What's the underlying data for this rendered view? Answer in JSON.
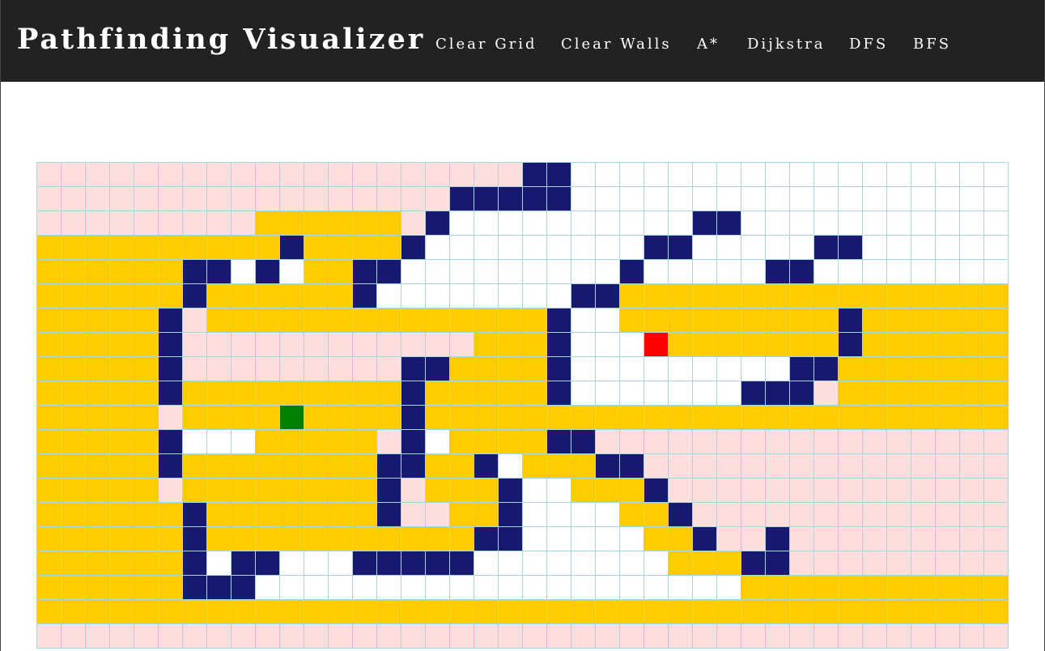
{
  "app": {
    "title": "Pathfinding Visualizer",
    "nav": [
      "Clear Grid",
      "Clear Walls",
      "A*",
      "Dijkstra",
      "DFS",
      "BFS"
    ]
  },
  "legend": {
    "P": {
      "meaning": "visited",
      "color": "#ffdede"
    },
    "Y": {
      "meaning": "path",
      "color": "#ffcc00"
    },
    "W": {
      "meaning": "wall",
      "color": "#191970"
    },
    "E": {
      "meaning": "empty",
      "color": "#ffffff"
    },
    "S": {
      "meaning": "start",
      "color": "#008000"
    },
    "T": {
      "meaning": "target",
      "color": "#ff0000"
    }
  },
  "grid": {
    "rows": 20,
    "cols": 40,
    "cells": [
      "PPPPPPPPPPPPPPPPPPPPWWEEEEEEEEEEEEEEEEEE",
      "PPPPPPPPPPPPPPPPPWWWWWEEEEEEEEEEEEEEEEEE",
      "PPPPPPPPPYYYYYYPWEEEEEEEEEEWWEEEEEEEEEEE",
      "YYYYYYYYYYWYYYYWEEEEEEEEEWWEEEEEWWEEEEEE",
      "YYYYYYWWEWEYYWWEEEEEEEEEWEEEEEWWEEEEEEEE",
      "YYYYYYWYYYYYYWEEEEEEEEWWYYYYYYYYYYYYYYYY",
      "YYYYYWPYYYYYYYYYYYYYYWEEYYYYYYYYYWYYYYYY",
      "YYYYYWPPPPPPPPPPPPYYYWEEETYYYYYYYWYYYYYY",
      "YYYYYWPPPPPPPPPWWYYYYWEEEEEEEEEWWYYYYYYY",
      "YYYYYWYYYYYYYYYWYYYYYWEEEEEEEWWWPYYYYYYY",
      "YYYYYPYYYYSYYYYWYYYYYYYYYYYYYYYYYYYYYYYY",
      "YYYYYWEEEYYYYYPWEYYYYWWPPPPPPPPPPPPPPPPP",
      "YYYYYWYYYYYYYYWWYYWEYYYWWPPPPPPPPPPPPPPP",
      "YYYYYPYYYYYYYYWPYYYWEEYYYWPPPPPPPPPPPPPP",
      "YYYYYYWYYYYYYYWPPYYWEEEEYYWPPPPPPPPPPPPP",
      "YYYYYYWYYYYYYYYYYYWWEEEEEYYWPPWPPPPPPPPP",
      "YYYYYYWEWWEEEWWWWWEEEEEEEEYYYWWPPPPPPPPP",
      "YYYYYYWWWEEEEEEEEEEEEEEEEEEEEYYYYYYYYYYY",
      "YYYYYYYYYYYYYYYYYYYYYYYYYYYYYYYYYYYYYYYY",
      "PPPPPPPPPPPPPPPPPPPPPPPPPPPPPPPPPPPPPPPP"
    ]
  }
}
